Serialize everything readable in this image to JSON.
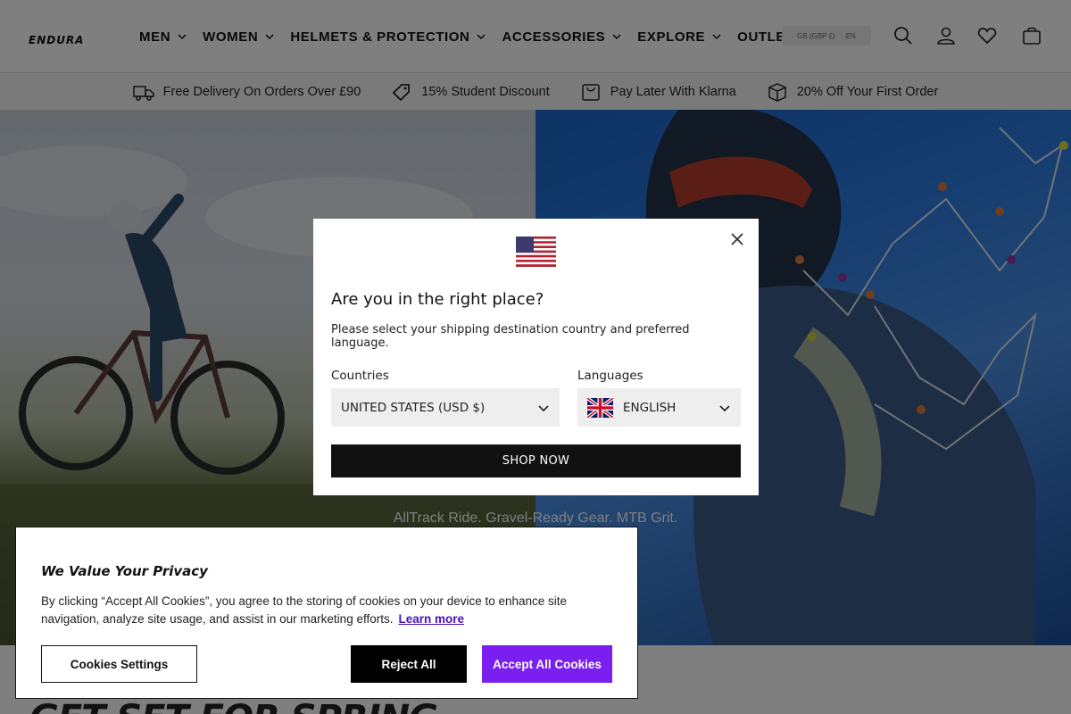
{
  "header": {
    "logo_text": "ENDURA",
    "nav": [
      {
        "label": "MEN",
        "has_dropdown": true
      },
      {
        "label": "WOMEN",
        "has_dropdown": true
      },
      {
        "label": "HELMETS & PROTECTION",
        "has_dropdown": true
      },
      {
        "label": "ACCESSORIES",
        "has_dropdown": true
      },
      {
        "label": "EXPLORE",
        "has_dropdown": true
      },
      {
        "label": "OUTLET",
        "has_dropdown": false
      }
    ],
    "locale_currency": "GB (GBP £)",
    "locale_language": "EN",
    "icons": [
      "search-icon",
      "account-icon",
      "wishlist-icon",
      "cart-icon"
    ]
  },
  "usp_bar": [
    {
      "icon": "delivery-truck-icon",
      "text": "Free Delivery On Orders Over £90"
    },
    {
      "icon": "tag-icon",
      "text": "15% Student Discount"
    },
    {
      "icon": "bag-icon",
      "text": "Pay Later With Klarna"
    },
    {
      "icon": "box-icon",
      "text": "20% Off Your First Order"
    }
  ],
  "hero": {
    "tagline": "AllTrack Ride. Gravel-Ready Gear. MTB Grit."
  },
  "country_modal": {
    "title": "Are you in the right place?",
    "description": "Please select your shipping destination country and preferred language.",
    "countries_label": "Countries",
    "countries_value": "UNITED STATES (USD $)",
    "languages_label": "Languages",
    "languages_value": "ENGLISH",
    "shop_button": "SHOP NOW"
  },
  "cookie_banner": {
    "title": "We Value Your Privacy",
    "text": "By clicking “Accept All Cookies”, you agree to the storing of cookies on your device to enhance site navigation, analyze site usage, and assist in our marketing efforts.",
    "learn_more": "Learn more",
    "settings_button": "Cookies Settings",
    "reject_button": "Reject All",
    "accept_button": "Accept All Cookies"
  },
  "page_headline": "GET SET FOR SPRING",
  "colors": {
    "accept_purple": "#7b1ff0",
    "link_purple": "#4a0fbf",
    "overlay": "rgba(0,0,0,0.5)"
  }
}
